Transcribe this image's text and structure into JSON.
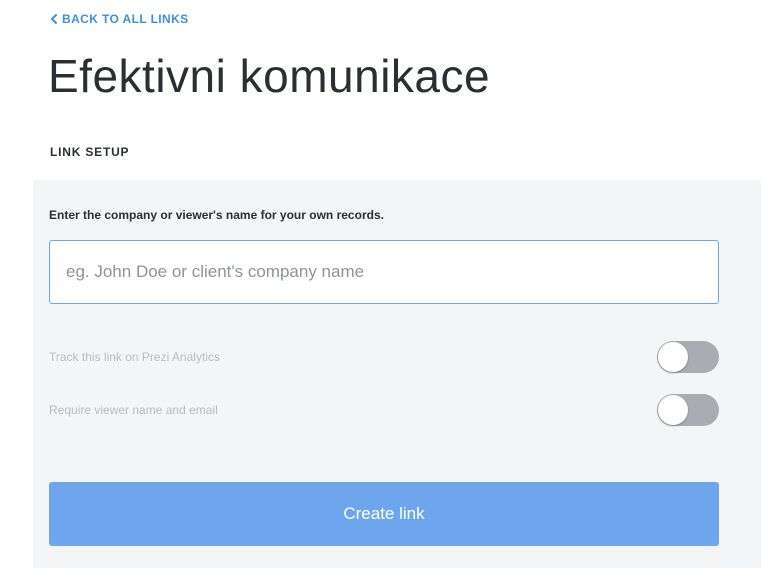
{
  "nav": {
    "back_label": "BACK TO ALL LINKS",
    "back_icon": "chevron-left-icon"
  },
  "header": {
    "title": "Efektivni komunikace"
  },
  "section": {
    "heading": "LINK SETUP"
  },
  "form": {
    "name_label": "Enter the company or viewer's name for your own records.",
    "name_value": "",
    "name_placeholder": "eg. John Doe or client's company name",
    "toggles": [
      {
        "label": "Track this link on Prezi Analytics",
        "enabled": false
      },
      {
        "label": "Require viewer name and email",
        "enabled": false
      }
    ],
    "submit_label": "Create link"
  },
  "colors": {
    "accent": "#3d8fe0",
    "button": "#6ea6ee",
    "panel": "#f4f5f6",
    "toggle_off": "#a9adb1"
  }
}
